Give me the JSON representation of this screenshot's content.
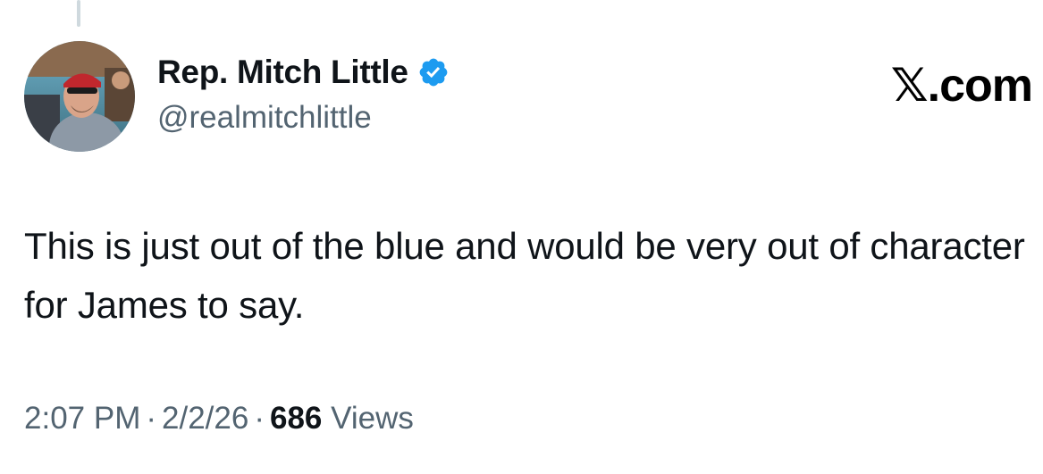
{
  "author": {
    "display_name": "Rep. Mitch Little",
    "handle": "@realmitchlittle",
    "verified": true,
    "verified_color": "#1d9bf0",
    "avatar_icon": "profile-photo"
  },
  "brand": {
    "label": "𝕏.com"
  },
  "tweet": {
    "text": "This is just out of the blue and would be very out of character for James to say."
  },
  "meta": {
    "time": "2:07 PM",
    "separator": "·",
    "date": "2/2/26",
    "views_count": "686",
    "views_label": "Views"
  },
  "colors": {
    "text_primary": "#0f1419",
    "text_secondary": "#536471",
    "thread_line": "#cfd9de"
  }
}
